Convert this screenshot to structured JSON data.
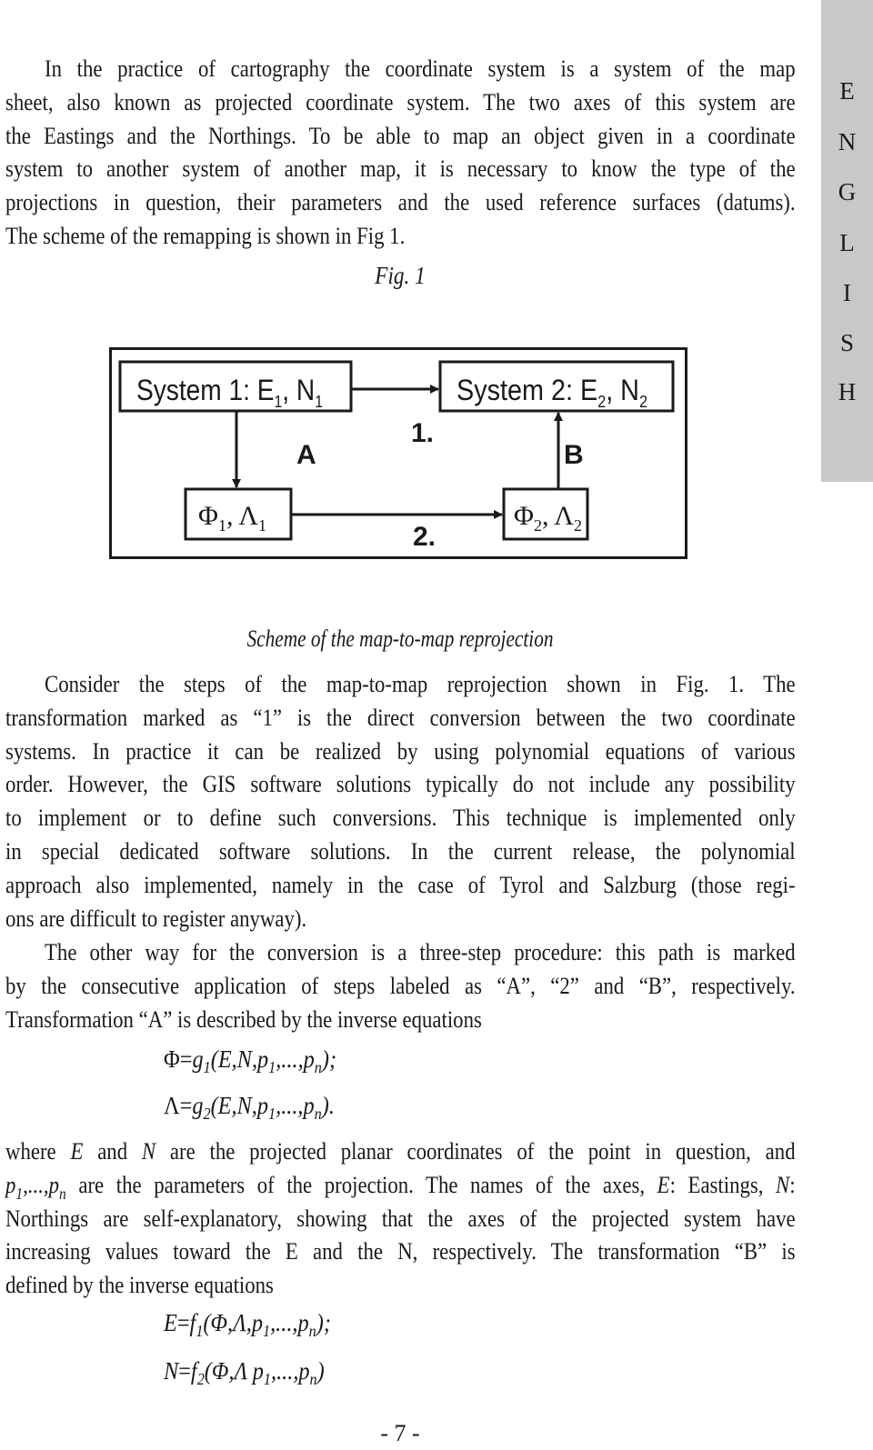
{
  "side_tab": {
    "letters": [
      "E",
      "N",
      "G",
      "L",
      "I",
      "S",
      "H"
    ]
  },
  "para1": [
    "In the practice of cartography the coordinate system is a system of the map",
    "sheet, also known as projected coordinate system. The two axes of this system are",
    "the Eastings and the Northings. To be able to map an object given in a coordinate",
    "system to another system of another map, it is necessary to know the type of the",
    "projections in question, their parameters and the used reference surfaces (datums).",
    "The scheme of the remapping is shown in Fig 1."
  ],
  "figure": {
    "label": "Fig. 1",
    "caption": "Scheme of the map-to-map reprojection",
    "nodes": {
      "system1": {
        "text": "System 1: E",
        "sub1": "1",
        "mid": ", N",
        "sub2": "1"
      },
      "system2": {
        "text": "System 2: E",
        "sub1": "2",
        "mid": ", N",
        "sub2": "2"
      },
      "geo1": {
        "text": "Φ",
        "sub1": "1",
        "mid": ", Λ",
        "sub2": "1"
      },
      "geo2": {
        "text": "Φ",
        "sub1": "2",
        "mid": ", Λ",
        "sub2": "2"
      }
    },
    "edges": {
      "direct": "1.",
      "inverse_a": "A",
      "datum": "2.",
      "forward_b": "B"
    }
  },
  "para2": [
    "Consider the steps of the map-to-map reprojection shown in Fig. 1. The",
    "transformation marked as “1” is the direct conversion between the two coordinate",
    "systems. In practice it can be realized by using polynomial equations of various",
    "order. However, the GIS software solutions typically do not include any possibility",
    "to implement or to define such conversions. This technique is implemented only",
    "in special dedicated software solutions. In the current release, the polynomial",
    "approach also implemented, namely in the case of Tyrol and Salzburg (those regi-",
    "ons are difficult to register anyway)."
  ],
  "para3": [
    "The other way for the conversion is a three-step procedure: this path is marked",
    "by the consecutive application of steps labeled as “A”, “2” and “B”, respectively.",
    "Transformation “A” is described by the inverse equations"
  ],
  "equations_a": [
    {
      "lhs": "Φ",
      "fn": "g",
      "idx": "1",
      "args": "(E,N,p",
      "p1": "1",
      "mid": ",...,p",
      "pn": "n",
      "end": ");"
    },
    {
      "lhs": "Λ",
      "fn": "g",
      "idx": "2",
      "args": "(E,N,p",
      "p1": "1",
      "mid": ",...,p",
      "pn": "n",
      "end": ")."
    }
  ],
  "para4": {
    "l1_a": "where ",
    "l1_E": "E",
    "l1_b": " and ",
    "l1_N": "N",
    "l1_c": " are the projected planar coordinates of the point in question, and",
    "l2_p": "p",
    "l2_1": "1",
    "l2_mid": ",...,p",
    "l2_n": "n",
    "l2_b": " are the parameters of the projection. The names of the axes, ",
    "l2_E": "E",
    "l2_c": ": Eastings, ",
    "l2_N": "N",
    "l2_d": ":",
    "l3": "Northings are self-explanatory, showing that the axes of the projected system have",
    "l4": "increasing values toward the E and the N, respectively. The transformation “B” is",
    "l5": "defined by the inverse equations"
  },
  "equations_b": [
    {
      "lhs": "E",
      "fn": "f",
      "idx": "1",
      "args": "(Φ,Λ,p",
      "p1": "1",
      "mid": ",...,p",
      "pn": "n",
      "end": ");"
    },
    {
      "lhs": "N",
      "fn": "f",
      "idx": "2",
      "args": "(Φ,Λ p",
      "p1": "1",
      "mid": ",...,p",
      "pn": "n",
      "end": ")"
    }
  ],
  "page_number": "- 7 -"
}
